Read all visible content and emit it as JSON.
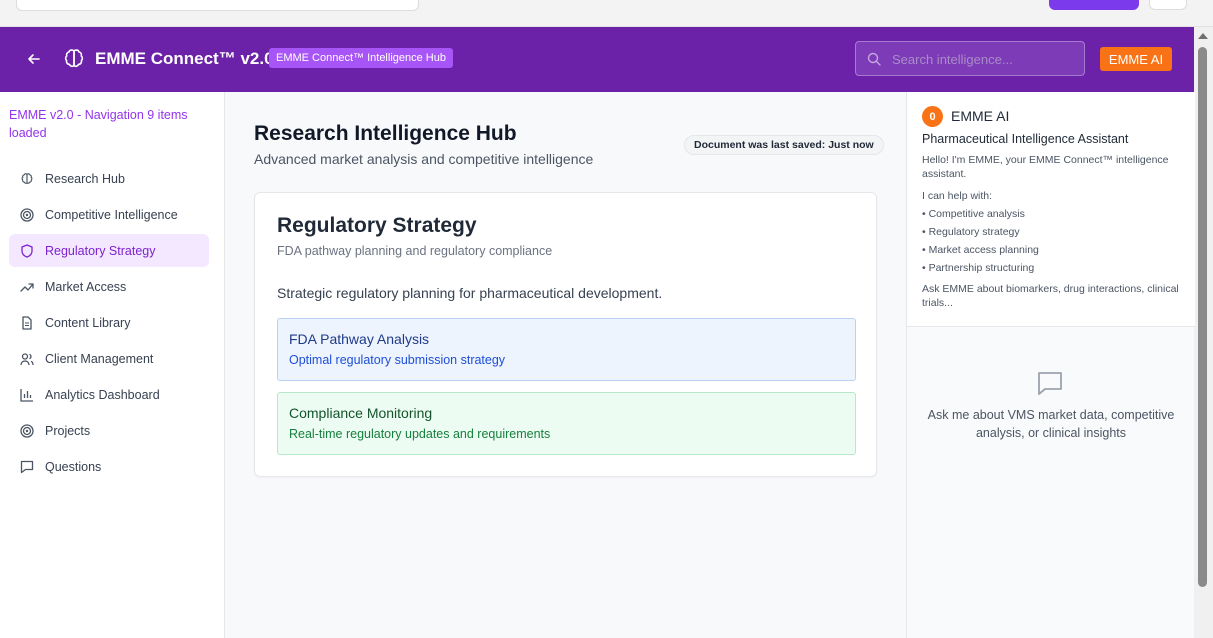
{
  "header": {
    "title": "EMME Connect™ v2.0",
    "badge": "EMME Connect™ Intelligence Hub",
    "search_placeholder": "Search intelligence...",
    "ai_button": "EMME AI",
    "colors": {
      "header_bg": "#6b21a8",
      "accent": "#f97316",
      "badge": "#a855f7"
    }
  },
  "sidebar": {
    "status": "EMME v2.0 - Navigation 9 items loaded",
    "items": [
      {
        "label": "Research Hub",
        "icon": "brain-icon",
        "active": false
      },
      {
        "label": "Competitive Intelligence",
        "icon": "target-icon",
        "active": false
      },
      {
        "label": "Regulatory Strategy",
        "icon": "shield-icon",
        "active": true
      },
      {
        "label": "Market Access",
        "icon": "trending-up-icon",
        "active": false
      },
      {
        "label": "Content Library",
        "icon": "document-icon",
        "active": false
      },
      {
        "label": "Client Management",
        "icon": "users-icon",
        "active": false
      },
      {
        "label": "Analytics Dashboard",
        "icon": "bar-chart-icon",
        "active": false
      },
      {
        "label": "Projects",
        "icon": "target-icon",
        "active": false
      },
      {
        "label": "Questions",
        "icon": "message-icon",
        "active": false
      }
    ]
  },
  "main": {
    "title": "Research Intelligence Hub",
    "subtitle": "Advanced market analysis and competitive intelligence",
    "save_status": "Document was last saved: Just now",
    "card": {
      "title": "Regulatory Strategy",
      "subtitle": "FDA pathway planning and regulatory compliance",
      "description": "Strategic regulatory planning for pharmaceutical development.",
      "features": [
        {
          "title": "FDA Pathway Analysis",
          "subtitle": "Optimal regulatory submission strategy"
        },
        {
          "title": "Compliance Monitoring",
          "subtitle": "Real-time regulatory updates and requirements"
        }
      ]
    }
  },
  "assistant": {
    "count": "0",
    "name": "EMME AI",
    "title": "Pharmaceutical Intelligence Assistant",
    "greeting": "Hello! I'm EMME, your EMME Connect™ intelligence assistant.",
    "help_intro": "I can help with:",
    "help_items": [
      "• Competitive analysis",
      "• Regulatory strategy",
      "• Market access planning",
      "• Partnership structuring"
    ],
    "prompt": "Ask EMME about biomarkers, drug interactions, clinical trials...",
    "empty_message": "Ask me about VMS market data, competitive analysis, or clinical insights"
  }
}
